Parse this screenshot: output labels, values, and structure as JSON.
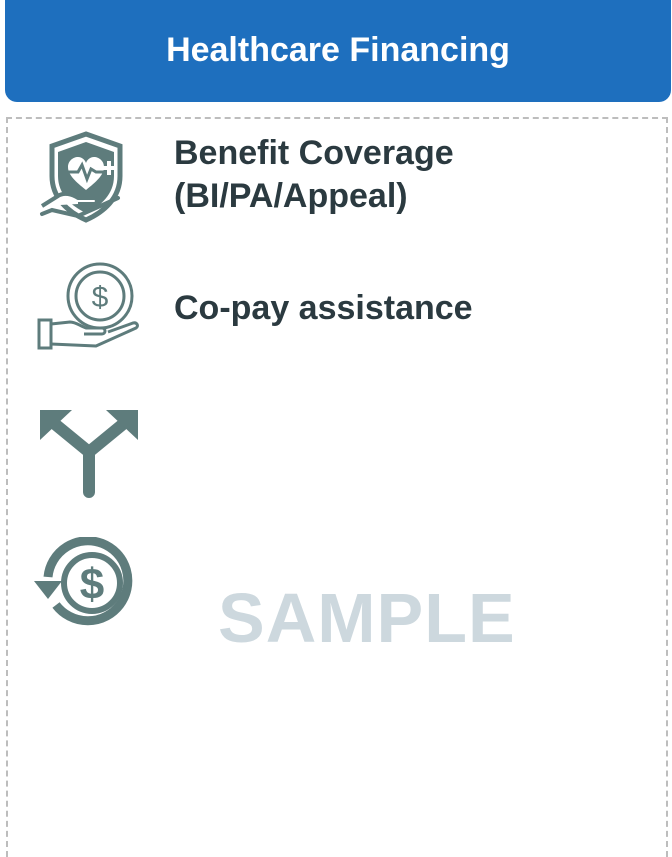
{
  "header": {
    "title": "Healthcare Financing"
  },
  "items": [
    {
      "icon": "heart-shield-hand-icon",
      "line1": "Benefit Coverage",
      "line2": "(BI/PA/Appeal)"
    },
    {
      "icon": "dollar-coin-hand-icon",
      "line1": "Co-pay assistance"
    },
    {
      "icon": "split-arrows-icon"
    },
    {
      "icon": "dollar-refund-icon"
    }
  ],
  "watermark": "SAMPLE",
  "colors": {
    "header_bg": "#1e6fbe",
    "icon": "#5e7c7c",
    "text": "#2b3a40",
    "watermark": "#cdd8de",
    "border": "#bdbdbd"
  }
}
